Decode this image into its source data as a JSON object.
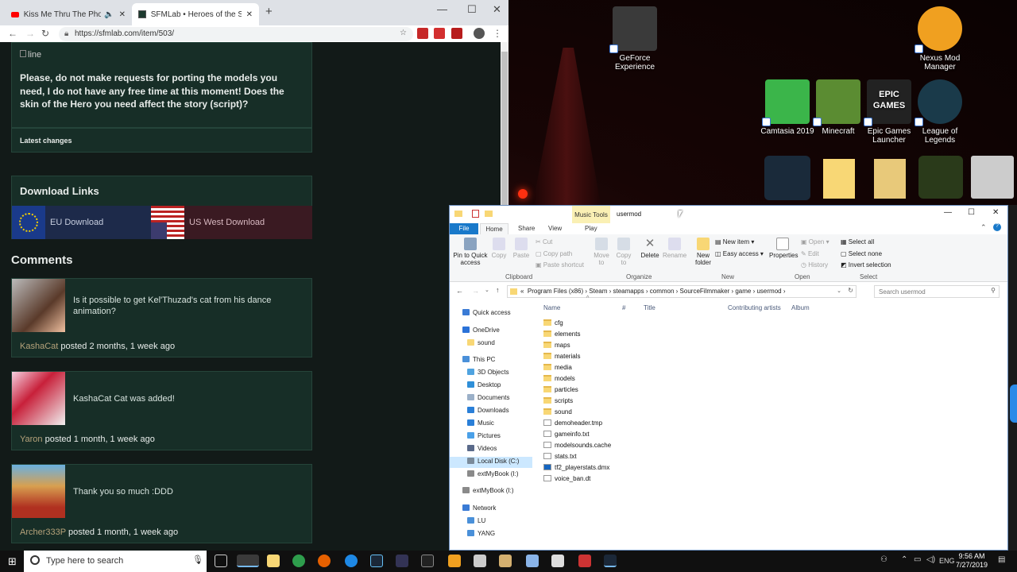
{
  "browser": {
    "tabs": [
      {
        "title": "Kiss Me Thru The Phone Inst..."
      },
      {
        "title": "SFMLab • Heroes of the Storm p..."
      }
    ],
    "url": "https://sfmlab.com/item/503/",
    "new_tab": "+",
    "controls": {
      "minimize": "—",
      "maximize": "☐",
      "close": "✕"
    }
  },
  "page": {
    "broken_image_alt": "line",
    "notice": "Please, do not make requests for porting the models you need, I do not have any free time at this moment! Does the skin of the Hero you need affect the story (script)?",
    "latest_changes": "Latest changes",
    "download_links_title": "Download Links",
    "downloads": [
      {
        "label": "EU Download",
        "color": "#1d2a4a"
      },
      {
        "label": "US West Download",
        "color": "#3a1a22"
      }
    ],
    "comments_title": "Comments",
    "comments": [
      {
        "text": "Is it possible to get Kel'Thuzad's cat from his dance animation?",
        "user": "KashaCat",
        "meta": "posted 2 months, 1 week ago"
      },
      {
        "text": "KashaCat Cat was added!",
        "user": "Yaron",
        "meta": "posted 1 month, 1 week ago"
      },
      {
        "text": "Thank you so much :DDD",
        "user": "Archer333P",
        "meta": "posted 1 month, 1 week ago"
      }
    ]
  },
  "desktop_icons": [
    {
      "label": "GeForce Experience",
      "color": "#3a3a3a",
      "icon": "geforce-icon"
    },
    {
      "label": "Nexus Mod Manager",
      "color": "#f0a020",
      "icon": "nexus-icon"
    },
    {
      "label": "Camtasia 2019",
      "color": "#3bb54a",
      "icon": "camtasia-icon"
    },
    {
      "label": "Minecraft",
      "color": "#5b8c32",
      "icon": "minecraft-icon"
    },
    {
      "label": "Epic Games Launcher",
      "color": "#222222",
      "icon": "epic-icon",
      "glyph": "EPIC GAMES"
    },
    {
      "label": "League of Legends",
      "color": "#1a3a4a",
      "icon": "league-icon"
    }
  ],
  "explorer": {
    "title": "usermod",
    "context_tab": "Music Tools",
    "tabs": [
      "File",
      "Home",
      "Share",
      "View",
      "Play"
    ],
    "ribbon": {
      "pin": "Pin to Quick access",
      "copy": "Copy",
      "paste": "Paste",
      "cut": "Cut",
      "copy_path": "Copy path",
      "paste_shortcut": "Paste shortcut",
      "move_to": "Move to",
      "copy_to": "Copy to",
      "delete": "Delete",
      "rename": "Rename",
      "new_folder": "New folder",
      "new_item": "New item",
      "easy_access": "Easy access",
      "properties": "Properties",
      "open": "Open",
      "edit": "Edit",
      "history": "History",
      "select_all": "Select all",
      "select_none": "Select none",
      "invert_selection": "Invert selection",
      "groups": [
        "Clipboard",
        "Organize",
        "New",
        "Open",
        "Select"
      ]
    },
    "breadcrumb": [
      "«",
      "Program Files (x86)",
      "Steam",
      "steamapps",
      "common",
      "SourceFilmmaker",
      "game",
      "usermod"
    ],
    "search_placeholder": "Search usermod",
    "columns": [
      "Name",
      "#",
      "Title",
      "Contributing artists",
      "Album"
    ],
    "sidebar": [
      {
        "label": "Quick access",
        "icon": "star-icon",
        "color": "#3a7bd5",
        "indent": 0
      },
      {
        "label": "OneDrive",
        "icon": "cloud-icon",
        "color": "#2a72d8",
        "indent": 0
      },
      {
        "label": "sound",
        "icon": "folder-icon",
        "color": "#f8d775",
        "indent": 1
      },
      {
        "label": "This PC",
        "icon": "pc-icon",
        "color": "#4a90d9",
        "indent": 0
      },
      {
        "label": "3D Objects",
        "icon": "cube-icon",
        "color": "#4fa3e0",
        "indent": 1
      },
      {
        "label": "Desktop",
        "icon": "desktop-icon",
        "color": "#2f8fd8",
        "indent": 1
      },
      {
        "label": "Documents",
        "icon": "documents-icon",
        "color": "#9bb0c8",
        "indent": 1
      },
      {
        "label": "Downloads",
        "icon": "download-icon",
        "color": "#2a7fd8",
        "indent": 1
      },
      {
        "label": "Music",
        "icon": "music-icon",
        "color": "#2a7fd8",
        "indent": 1
      },
      {
        "label": "Pictures",
        "icon": "pictures-icon",
        "color": "#4aa0e8",
        "indent": 1
      },
      {
        "label": "Videos",
        "icon": "videos-icon",
        "color": "#5a6a8a",
        "indent": 1
      },
      {
        "label": "Local Disk (C:)",
        "icon": "disk-icon",
        "color": "#7a8a9a",
        "indent": 1,
        "selected": true
      },
      {
        "label": "extMyBook (I:)",
        "icon": "disk-icon",
        "color": "#8a8a8a",
        "indent": 1
      },
      {
        "label": "extMyBook (I:)",
        "icon": "disk-icon",
        "color": "#8a8a8a",
        "indent": 0
      },
      {
        "label": "Network",
        "icon": "network-icon",
        "color": "#3a7bd5",
        "indent": 0
      },
      {
        "label": "LU",
        "icon": "computer-icon",
        "color": "#4a90d9",
        "indent": 1
      },
      {
        "label": "YANG",
        "icon": "computer-icon",
        "color": "#4a90d9",
        "indent": 1
      }
    ],
    "files": [
      {
        "name": "cfg",
        "type": "folder"
      },
      {
        "name": "elements",
        "type": "folder"
      },
      {
        "name": "maps",
        "type": "folder"
      },
      {
        "name": "materials",
        "type": "folder"
      },
      {
        "name": "media",
        "type": "folder"
      },
      {
        "name": "models",
        "type": "folder"
      },
      {
        "name": "particles",
        "type": "folder"
      },
      {
        "name": "scripts",
        "type": "folder"
      },
      {
        "name": "sound",
        "type": "folder"
      },
      {
        "name": "demoheader.tmp",
        "type": "file"
      },
      {
        "name": "gameinfo.txt",
        "type": "file"
      },
      {
        "name": "modelsounds.cache",
        "type": "file"
      },
      {
        "name": "stats.txt",
        "type": "file"
      },
      {
        "name": "tf2_playerstats.dmx",
        "type": "dmx"
      },
      {
        "name": "voice_ban.dt",
        "type": "file"
      }
    ]
  },
  "taskbar": {
    "search_placeholder": "Type here to search",
    "language": "ENG",
    "time": "9:56 AM",
    "date": "7/27/2019"
  }
}
